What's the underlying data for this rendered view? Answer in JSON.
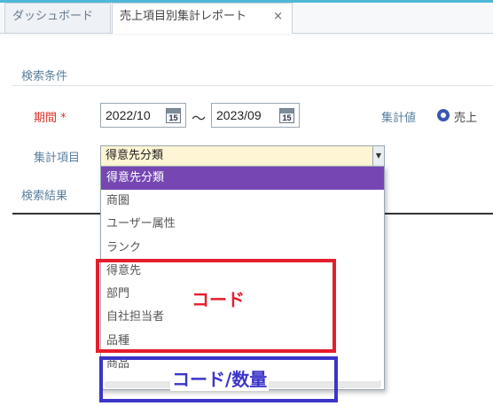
{
  "tabs": [
    {
      "label": "ダッシュボード"
    },
    {
      "label": "売上項目別集計レポート",
      "close": "×"
    }
  ],
  "conditions": {
    "title": "検索条件",
    "period_label": "期間",
    "required_mark": "*",
    "date_from": "2022/10",
    "date_to": "2023/09",
    "calendar_day": "15",
    "range_separator": "～",
    "aggregate_value_label": "集計値",
    "aggregate_option": "売上",
    "aggregate_option_next": "（",
    "aggregate_item_label": "集計項目",
    "selected_item": "得意先分類"
  },
  "dropdown": {
    "options": [
      "得意先分類",
      "商圏",
      "ユーザー属性",
      "ランク",
      "得意先",
      "部門",
      "自社担当者",
      "品種",
      "商品"
    ],
    "selected_index": 0
  },
  "results": {
    "title": "検索結果"
  },
  "annotations": {
    "red_label": "コード",
    "blue_label": "コード/数量",
    "red_color": "#e41e2c",
    "blue_color": "#3b35c9"
  },
  "colors": {
    "accent_bar": "#4fb8d8",
    "selected_option": "#7647b3",
    "input_highlight": "#fdf5d3"
  }
}
